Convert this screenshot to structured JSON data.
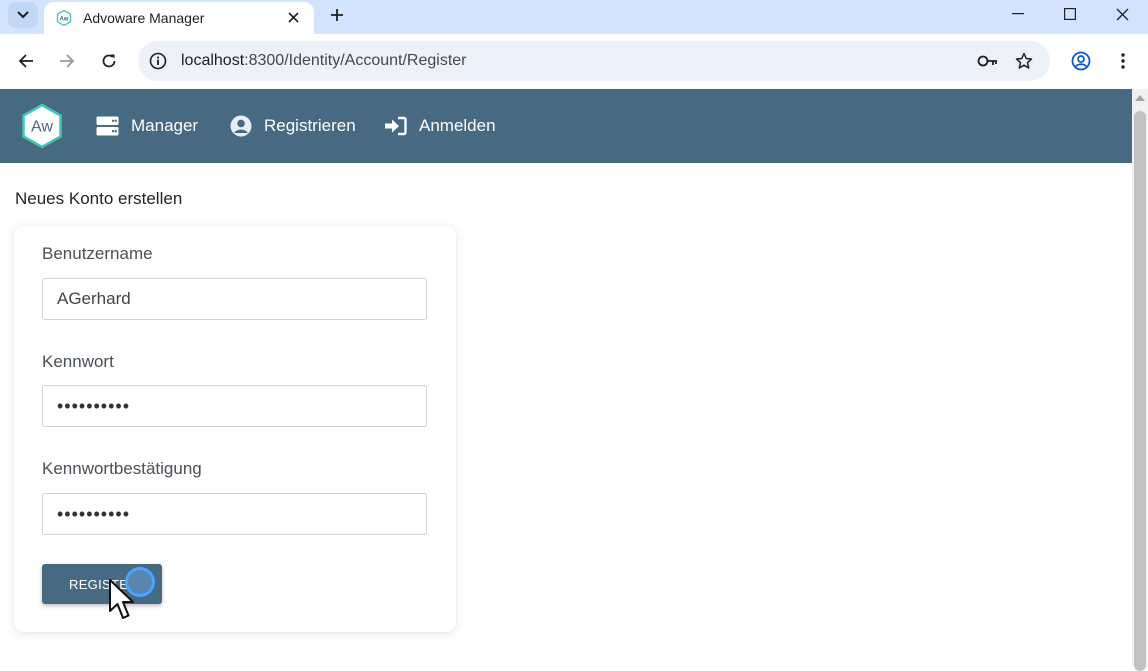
{
  "browser": {
    "tab_title": "Advoware Manager",
    "favicon_text": "Aw",
    "url_host": "localhost",
    "url_path": ":8300/Identity/Account/Register"
  },
  "navbar": {
    "logo_text": "Aw",
    "items": [
      {
        "label": "Manager",
        "icon": "server-icon"
      },
      {
        "label": "Registrieren",
        "icon": "user-circle-icon"
      },
      {
        "label": "Anmelden",
        "icon": "sign-in-icon"
      }
    ],
    "color": "#476981"
  },
  "page": {
    "title": "Neues Konto erstellen"
  },
  "form": {
    "username_label": "Benutzername",
    "username_value": "AGerhard",
    "password_label": "Kennwort",
    "password_value": "••••••••••",
    "confirm_label": "Kennwortbestätigung",
    "confirm_value": "••••••••••",
    "submit_label": "REGISTE"
  }
}
